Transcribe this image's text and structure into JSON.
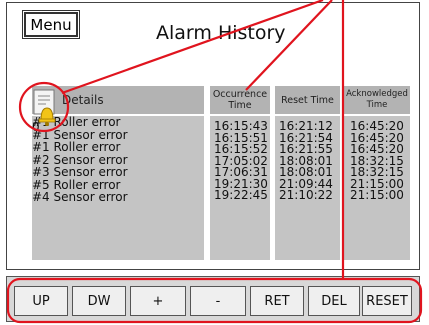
{
  "menu_label": "Menu",
  "title": "Alarm History",
  "columns": {
    "details": "Details",
    "occurrence": "Occurrence Time",
    "reset": "Reset Time",
    "acknowledged": "Acknowledged Time"
  },
  "rows": [
    {
      "detail": "#1 Roller error",
      "occ": "16:15:43",
      "reset": "16:21:12",
      "ack": "16:45:20"
    },
    {
      "detail": "#1 Sensor error",
      "occ": "16:15:51",
      "reset": "16:21:54",
      "ack": "16:45:20"
    },
    {
      "detail": "#1 Roller error",
      "occ": "16:15:52",
      "reset": "16:21:55",
      "ack": "16:45:20"
    },
    {
      "detail": "#2 Sensor error",
      "occ": "17:05:02",
      "reset": "18:08:01",
      "ack": "18:32:15"
    },
    {
      "detail": "#3 Sensor error",
      "occ": "17:06:31",
      "reset": "18:08:01",
      "ack": "18:32:15"
    },
    {
      "detail": "#5 Roller error",
      "occ": "19:21:30",
      "reset": "21:09:44",
      "ack": "21:15:00"
    },
    {
      "detail": "#4 Sensor error",
      "occ": "19:22:45",
      "reset": "21:10:22",
      "ack": "21:15:00"
    }
  ],
  "buttons": [
    "UP",
    "DW",
    "+",
    "-",
    "RET",
    "DEL",
    "RESET"
  ],
  "icon": "alarm-bell-icon",
  "colors": {
    "annotation": "#e0141e",
    "header": "#b3b3b3",
    "column": "#c4c4c4"
  }
}
